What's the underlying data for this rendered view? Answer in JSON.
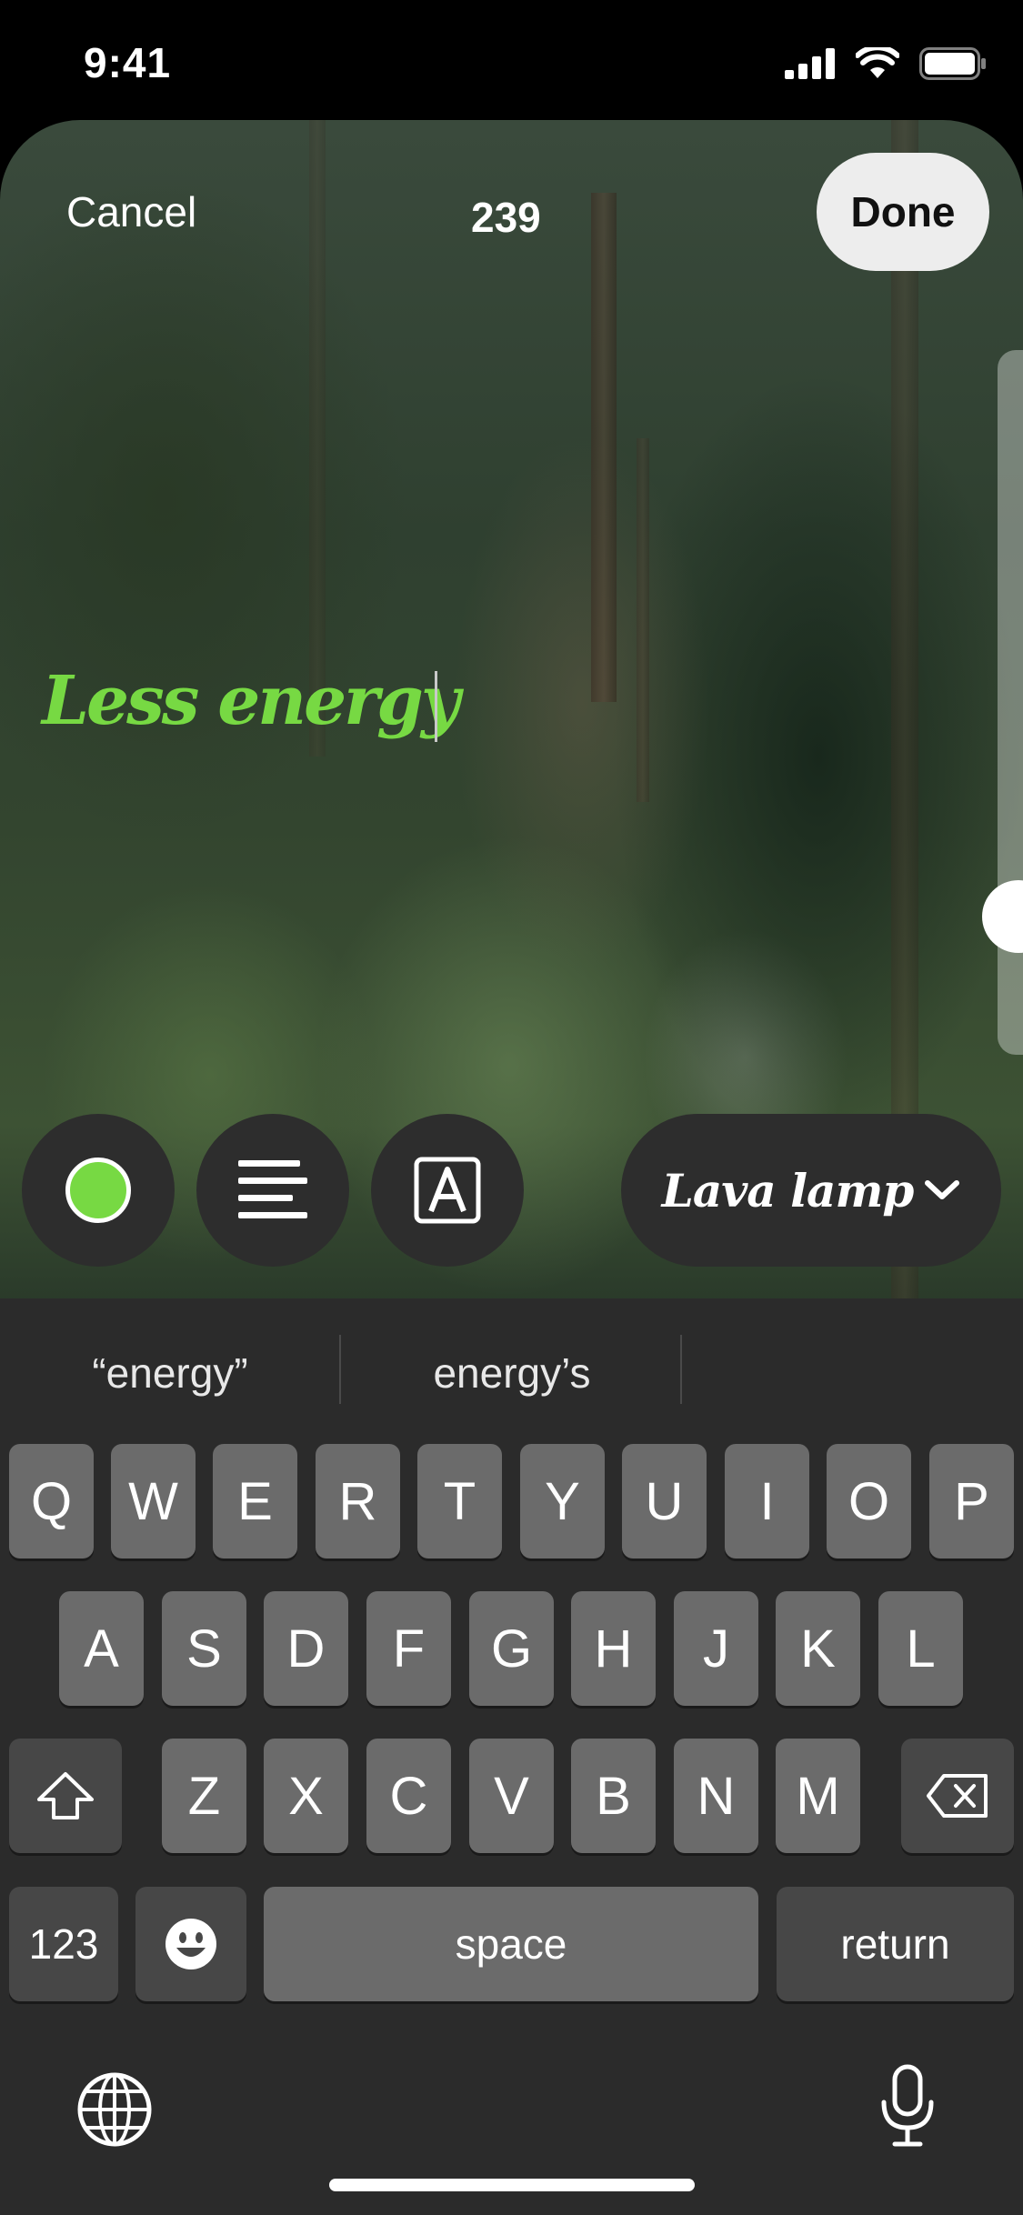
{
  "status_bar": {
    "time": "9:41"
  },
  "editor": {
    "cancel_label": "Cancel",
    "char_count": "239",
    "done_label": "Done",
    "text": "Less energy",
    "text_color": "#77d943",
    "font_name": "Lava lamp"
  },
  "keyboard": {
    "suggestions": [
      "“energy”",
      "energy’s",
      ""
    ],
    "row1": [
      "Q",
      "W",
      "E",
      "R",
      "T",
      "Y",
      "U",
      "I",
      "O",
      "P"
    ],
    "row2": [
      "A",
      "S",
      "D",
      "F",
      "G",
      "H",
      "J",
      "K",
      "L"
    ],
    "row3": [
      "Z",
      "X",
      "C",
      "V",
      "B",
      "N",
      "M"
    ],
    "numbers_label": "123",
    "space_label": "space",
    "return_label": "return"
  }
}
